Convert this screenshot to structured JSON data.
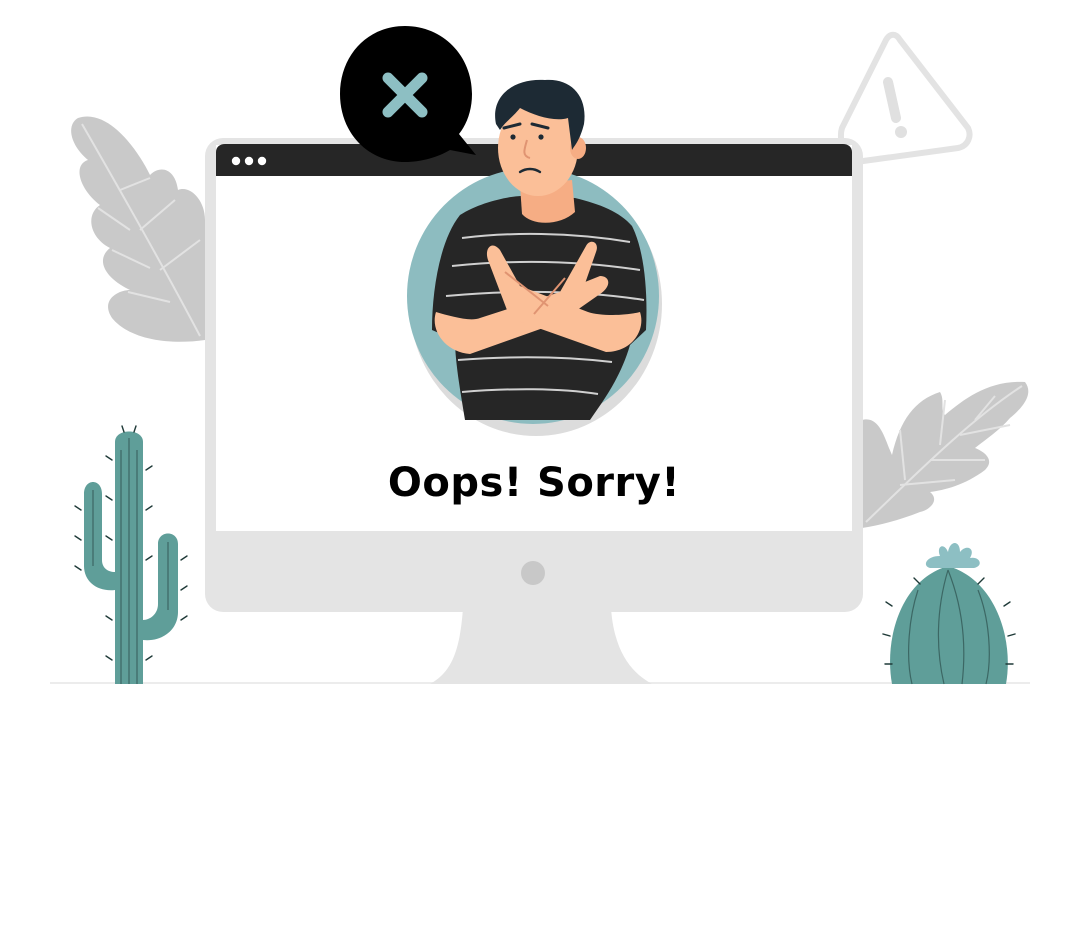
{
  "message": {
    "headline": "Oops! Sorry!"
  },
  "icons": {
    "speech_bubble": "close-x-icon",
    "warning": "warning-triangle-icon",
    "browser_controls": "window-dots-icon"
  },
  "colors": {
    "cactus": "#5f9e99",
    "cactus_dark": "#1f3a38",
    "x_mark": "#8dbfc3",
    "circle_backdrop": "#8dbcc0",
    "monitor": "#e4e4e4",
    "browser_bar": "#262626",
    "plants": "#c9c9c9",
    "skin": "#fbbf98",
    "hair": "#1d2a34",
    "shirt": "#262626"
  }
}
